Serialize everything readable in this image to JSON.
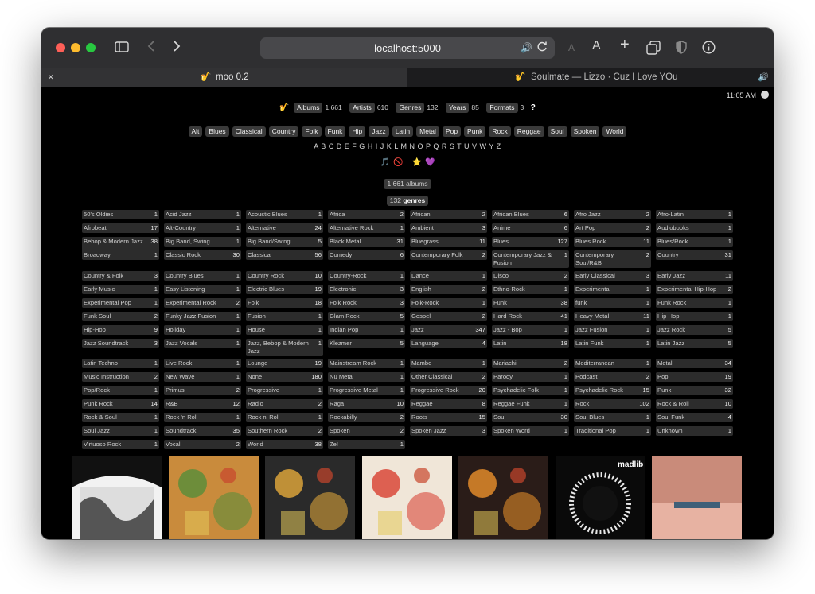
{
  "browser": {
    "url": "localhost:5000",
    "tabs": [
      {
        "label": "moo 0.2",
        "icon": "saxophone-icon"
      },
      {
        "label": "Soulmate — Lizzo · Cuz I Love YOu",
        "icon": "saxophone-icon"
      }
    ]
  },
  "clock": "11:05 AM",
  "topnav": {
    "items": [
      {
        "label": "Albums",
        "count": "1,661"
      },
      {
        "label": "Artists",
        "count": "610"
      },
      {
        "label": "Genres",
        "count": "132"
      },
      {
        "label": "Years",
        "count": "85"
      },
      {
        "label": "Formats",
        "count": "3"
      }
    ],
    "help": "?"
  },
  "quick_genres": [
    "Alt",
    "Blues",
    "Classical",
    "Country",
    "Folk",
    "Funk",
    "Hip",
    "Jazz",
    "Latin",
    "Metal",
    "Pop",
    "Punk",
    "Rock",
    "Reggae",
    "Soul",
    "Spoken",
    "World"
  ],
  "letters": "A B C D E F G H I J K L M N O P Q R S T U V W Y Z",
  "filters": [
    "🎵",
    "🚫",
    "⭐",
    "💜"
  ],
  "album_count": "1,661 albums",
  "genre_count_num": "132",
  "genre_count_label": "genres",
  "genres": [
    [
      "50's Oldies",
      "1"
    ],
    [
      "Acid Jazz",
      "1"
    ],
    [
      "Acoustic Blues",
      "1"
    ],
    [
      "Africa",
      "2"
    ],
    [
      "African",
      "2"
    ],
    [
      "African Blues",
      "6"
    ],
    [
      "Afro Jazz",
      "2"
    ],
    [
      "Afro-Latin",
      "1"
    ],
    [
      "Afrobeat",
      "17"
    ],
    [
      "Alt-Country",
      "1"
    ],
    [
      "Alternative",
      "24"
    ],
    [
      "Alternative Rock",
      "1"
    ],
    [
      "Ambient",
      "3"
    ],
    [
      "Anime",
      "6"
    ],
    [
      "Art Pop",
      "2"
    ],
    [
      "Audiobooks",
      "1"
    ],
    [
      "Bebop & Modern Jazz",
      "38"
    ],
    [
      "Big Band, Swing",
      "1"
    ],
    [
      "Big Band/Swing",
      "5"
    ],
    [
      "Black Metal",
      "31"
    ],
    [
      "Bluegrass",
      "11"
    ],
    [
      "Blues",
      "127"
    ],
    [
      "Blues Rock",
      "11"
    ],
    [
      "Blues/Rock",
      "1"
    ],
    [
      "Broadway",
      "1"
    ],
    [
      "Classic Rock",
      "30"
    ],
    [
      "Classical",
      "56"
    ],
    [
      "Comedy",
      "6"
    ],
    [
      "Contemporary Folk",
      "2"
    ],
    [
      "Contemporary Jazz & Fusion",
      "1"
    ],
    [
      "Contemporary Soul/R&B",
      "2"
    ],
    [
      "Country",
      "31"
    ],
    [
      "Country & Folk",
      "3"
    ],
    [
      "Country Blues",
      "1"
    ],
    [
      "Country Rock",
      "10"
    ],
    [
      "Country-Rock",
      "1"
    ],
    [
      "Dance",
      "1"
    ],
    [
      "Disco",
      "2"
    ],
    [
      "Early Classical",
      "3"
    ],
    [
      "Early Jazz",
      "11"
    ],
    [
      "Early Music",
      "1"
    ],
    [
      "Easy Listening",
      "1"
    ],
    [
      "Electric Blues",
      "19"
    ],
    [
      "Electronic",
      "3"
    ],
    [
      "English",
      "2"
    ],
    [
      "Ethno-Rock",
      "1"
    ],
    [
      "Experimental",
      "1"
    ],
    [
      "Experimental Hip-Hop",
      "2"
    ],
    [
      "Experimental Pop",
      "1"
    ],
    [
      "Experimental Rock",
      "2"
    ],
    [
      "Folk",
      "18"
    ],
    [
      "Folk Rock",
      "3"
    ],
    [
      "Folk-Rock",
      "1"
    ],
    [
      "Funk",
      "38"
    ],
    [
      "funk",
      "1"
    ],
    [
      "Funk Rock",
      "1"
    ],
    [
      "Funk Soul",
      "2"
    ],
    [
      "Funky Jazz Fusion",
      "1"
    ],
    [
      "Fusion",
      "1"
    ],
    [
      "Glam Rock",
      "5"
    ],
    [
      "Gospel",
      "2"
    ],
    [
      "Hard Rock",
      "41"
    ],
    [
      "Heavy Metal",
      "11"
    ],
    [
      "Hip Hop",
      "1"
    ],
    [
      "Hip-Hop",
      "9"
    ],
    [
      "Holiday",
      "1"
    ],
    [
      "House",
      "1"
    ],
    [
      "Indian Pop",
      "1"
    ],
    [
      "Jazz",
      "347"
    ],
    [
      "Jazz - Bop",
      "1"
    ],
    [
      "Jazz Fusion",
      "1"
    ],
    [
      "Jazz Rock",
      "5"
    ],
    [
      "Jazz Soundtrack",
      "3"
    ],
    [
      "Jazz Vocals",
      "1"
    ],
    [
      "Jazz, Bebop & Modern Jazz",
      "1"
    ],
    [
      "Klezmer",
      "5"
    ],
    [
      "Language",
      "4"
    ],
    [
      "Latin",
      "18"
    ],
    [
      "Latin Funk",
      "1"
    ],
    [
      "Latin Jazz",
      "5"
    ],
    [
      "Latin Techno",
      "1"
    ],
    [
      "Live Rock",
      "1"
    ],
    [
      "Lounge",
      "19"
    ],
    [
      "Mainstream Rock",
      "1"
    ],
    [
      "Mambo",
      "1"
    ],
    [
      "Mariachi",
      "2"
    ],
    [
      "Mediterranean",
      "1"
    ],
    [
      "Metal",
      "34"
    ],
    [
      "Music Instruction",
      "2"
    ],
    [
      "New Wave",
      "1"
    ],
    [
      "None",
      "180"
    ],
    [
      "Nu Metal",
      "1"
    ],
    [
      "Other Classical",
      "2"
    ],
    [
      "Parody",
      "1"
    ],
    [
      "Podcast",
      "2"
    ],
    [
      "Pop",
      "19"
    ],
    [
      "Pop/Rock",
      "1"
    ],
    [
      "Primus",
      "2"
    ],
    [
      "Progressive",
      "1"
    ],
    [
      "Progressive Metal",
      "1"
    ],
    [
      "Progressive Rock",
      "20"
    ],
    [
      "Psychadelic Folk",
      "1"
    ],
    [
      "Psychadelic Rock",
      "15"
    ],
    [
      "Punk",
      "32"
    ],
    [
      "Punk Rock",
      "14"
    ],
    [
      "R&B",
      "12"
    ],
    [
      "Radio",
      "2"
    ],
    [
      "Raga",
      "10"
    ],
    [
      "Reggae",
      "8"
    ],
    [
      "Reggae Funk",
      "1"
    ],
    [
      "Rock",
      "102"
    ],
    [
      "Rock & Roll",
      "10"
    ],
    [
      "Rock & Soul",
      "1"
    ],
    [
      "Rock 'n Roll",
      "1"
    ],
    [
      "Rock n' Roll",
      "1"
    ],
    [
      "Rockabilly",
      "2"
    ],
    [
      "Roots",
      "15"
    ],
    [
      "Soul",
      "30"
    ],
    [
      "Soul Blues",
      "1"
    ],
    [
      "Soul Funk",
      "4"
    ],
    [
      "Soul Jazz",
      "1"
    ],
    [
      "Soundtrack",
      "35"
    ],
    [
      "Southern Rock",
      "2"
    ],
    [
      "Spoken",
      "2"
    ],
    [
      "Spoken Jazz",
      "3"
    ],
    [
      "Spoken Word",
      "1"
    ],
    [
      "Traditional Pop",
      "1"
    ],
    [
      "Unknown",
      "1"
    ],
    [
      "Virtuoso Rock",
      "1"
    ],
    [
      "Vocal",
      "2"
    ],
    [
      "World",
      "38"
    ],
    [
      "Ze!",
      "1"
    ]
  ],
  "covers": [
    {
      "colors": [
        "#f2f2f2",
        "#111111"
      ]
    },
    {
      "colors": [
        "#c98b3c",
        "#5d8d3a"
      ]
    },
    {
      "colors": [
        "#2a2a2a",
        "#d9a23a"
      ]
    },
    {
      "colors": [
        "#f0e6d8",
        "#d9483a"
      ]
    },
    {
      "colors": [
        "#2a1c18",
        "#e08a2a"
      ]
    },
    {
      "colors": [
        "#0a0a0a",
        "#e8e8e8"
      ],
      "text": "madlib"
    },
    {
      "colors": [
        "#c98b7a",
        "#e7b2a2"
      ]
    }
  ]
}
